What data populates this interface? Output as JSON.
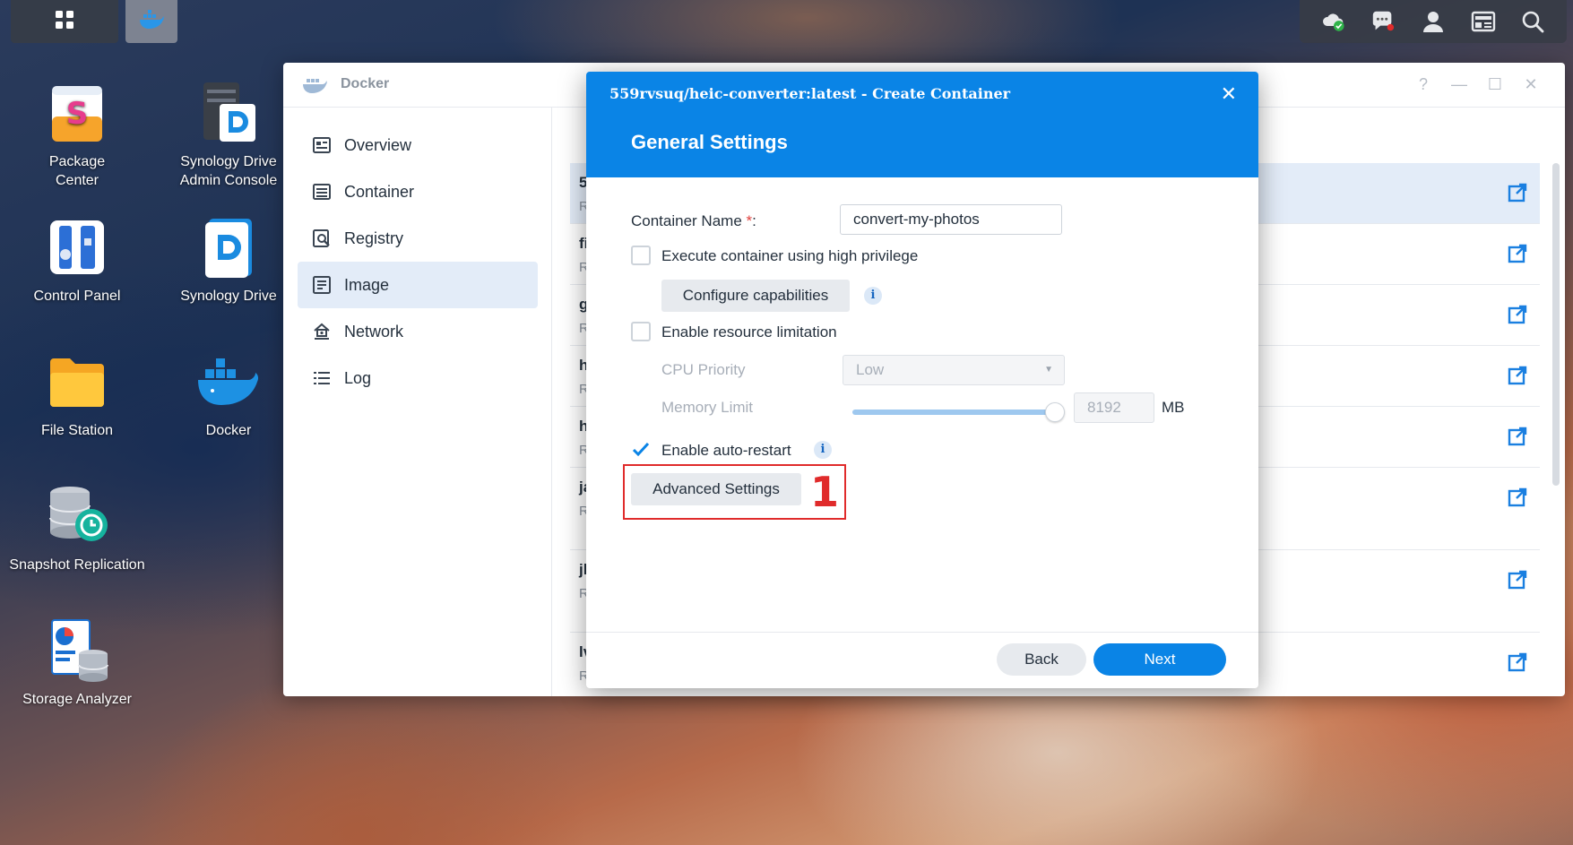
{
  "taskbar": {
    "grid_icon": "app-grid-icon",
    "docker_icon": "docker-whale-icon",
    "right_icons": [
      "cloud-sync-icon",
      "chat-icon",
      "user-icon",
      "widgets-icon",
      "search-icon"
    ]
  },
  "desktop": {
    "icons": [
      {
        "label": "Package\nCenter",
        "icon": "package-center-icon"
      },
      {
        "label": "Synology Drive\nAdmin Console",
        "icon": "drive-admin-icon"
      },
      {
        "label": "Control Panel",
        "icon": "control-panel-icon"
      },
      {
        "label": "Synology Drive",
        "icon": "synology-drive-icon"
      },
      {
        "label": "File Station",
        "icon": "file-station-icon"
      },
      {
        "label": "Docker",
        "icon": "docker-icon"
      },
      {
        "label": "Snapshot Replication",
        "icon": "snapshot-replication-icon"
      },
      {
        "label": "Storage Analyzer",
        "icon": "storage-analyzer-icon"
      }
    ]
  },
  "docker_window": {
    "title": "Docker",
    "controls": {
      "help": "?",
      "minimize": "—",
      "maximize": "☐",
      "close": "✕"
    },
    "nav": [
      {
        "label": "Overview",
        "icon": "overview-icon"
      },
      {
        "label": "Container",
        "icon": "container-icon"
      },
      {
        "label": "Registry",
        "icon": "registry-icon"
      },
      {
        "label": "Image",
        "icon": "image-icon",
        "active": true
      },
      {
        "label": "Network",
        "icon": "network-icon"
      },
      {
        "label": "Log",
        "icon": "log-icon"
      }
    ],
    "list_rows": [
      {
        "l1": "5",
        "l2": "R"
      },
      {
        "l1": "fi",
        "l2": "R"
      },
      {
        "l1": "g",
        "l2": "R"
      },
      {
        "l1": "h",
        "l2": "R"
      },
      {
        "l1": "h",
        "l2": "R"
      },
      {
        "l1": "ja",
        "l2": "R"
      },
      {
        "l1": "jl",
        "l2": "R"
      },
      {
        "l1": "lv",
        "l2": "R"
      }
    ]
  },
  "modal": {
    "title": "559rvsuq/heic-converter:latest - Create Container",
    "close": "✕",
    "section_title": "General Settings",
    "container_name_label": "Container Name",
    "required_mark": "*",
    "label_suffix": ":",
    "container_name_value": "convert-my-photos",
    "high_privilege_label": "Execute container using high privilege",
    "high_privilege_checked": false,
    "configure_capabilities_label": "Configure capabilities",
    "resource_limit_label": "Enable resource limitation",
    "resource_limit_checked": false,
    "cpu_priority_label": "CPU Priority",
    "cpu_priority_value": "Low",
    "memory_limit_label": "Memory Limit",
    "memory_limit_value": "8192",
    "memory_unit": "MB",
    "memory_slider_fraction": 1.0,
    "auto_restart_label": "Enable auto-restart",
    "auto_restart_checked": true,
    "advanced_settings_label": "Advanced Settings",
    "info_glyph": "i",
    "back_label": "Back",
    "next_label": "Next"
  },
  "annotation": {
    "number": "1",
    "color": "#e02b2b"
  },
  "colors": {
    "accent": "#0a84e6",
    "nav_active": "#e3ecf8"
  }
}
